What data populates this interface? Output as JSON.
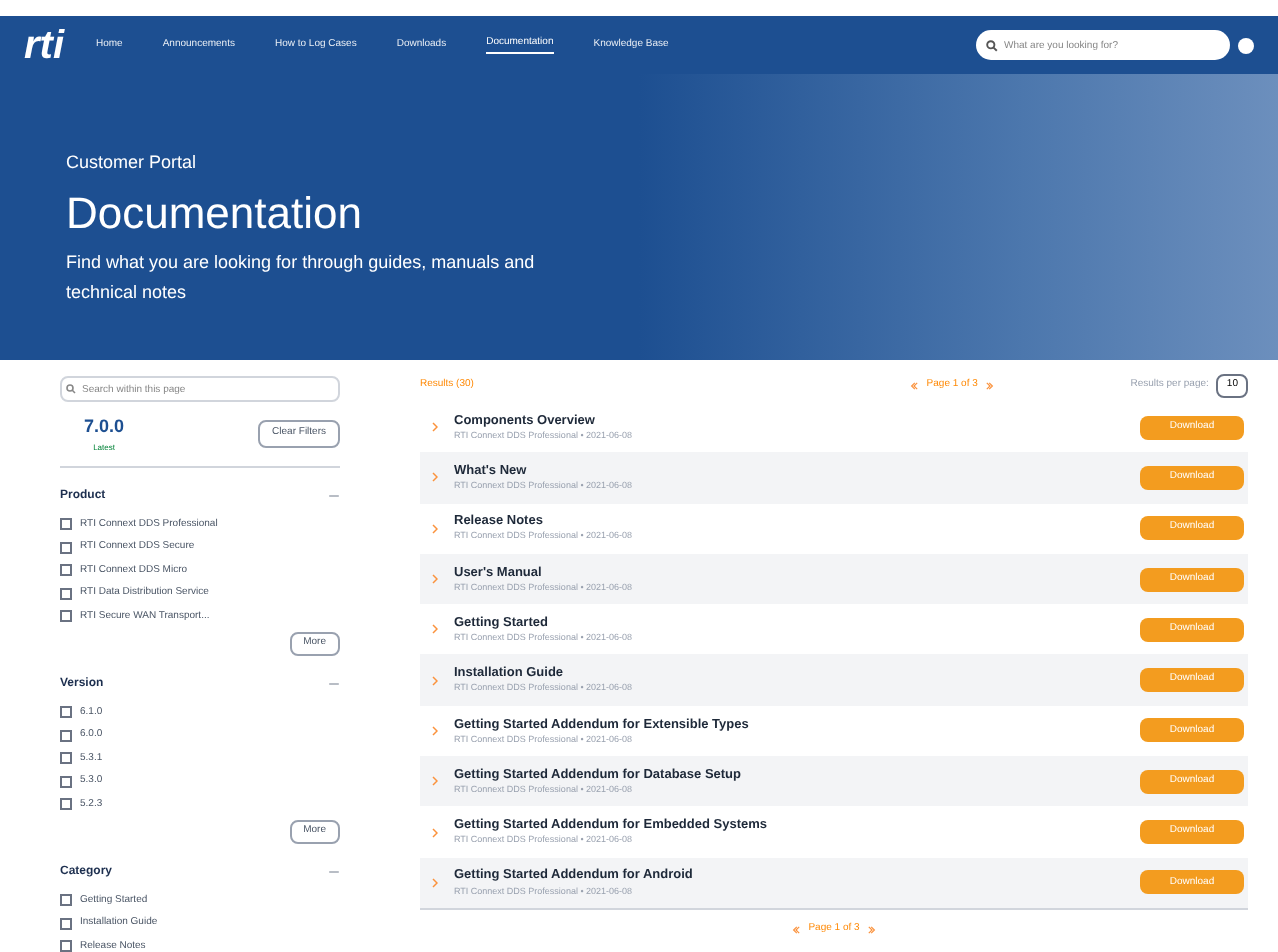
{
  "nav": {
    "logo": "rti",
    "items": [
      {
        "label": "Home",
        "selected": false
      },
      {
        "label": "Announcements",
        "selected": false
      },
      {
        "label": "How to Log Cases",
        "selected": false
      },
      {
        "label": "Downloads",
        "selected": false
      },
      {
        "label": "Documentation",
        "selected": true
      },
      {
        "label": "Knowledge Base",
        "selected": false
      }
    ],
    "search": {
      "placeholder": "What are you looking for?"
    }
  },
  "hero": {
    "eyebrow": "Customer Portal",
    "title": "Documentation",
    "subtitle": "Find what you are looking for through guides, manuals and technical notes"
  },
  "sidebar": {
    "search": {
      "placeholder": "Search within this page"
    },
    "version_badge": "7.0.0",
    "version_caption": "Latest",
    "clear_button": "Clear Filters",
    "groups": [
      {
        "title": "Product",
        "expanded": true,
        "options": [
          {
            "label": "RTI Connext DDS Professional",
            "checked": false
          },
          {
            "label": "RTI Connext DDS Secure",
            "checked": false
          },
          {
            "label": "RTI Connext DDS Micro",
            "checked": false
          },
          {
            "label": "RTI Data Distribution Service",
            "checked": false
          },
          {
            "label": "RTI Secure WAN Transport...",
            "checked": false
          }
        ],
        "more": "More"
      },
      {
        "title": "Version",
        "expanded": true,
        "options": [
          {
            "label": "6.1.0",
            "checked": false
          },
          {
            "label": "6.0.0",
            "checked": false
          },
          {
            "label": "5.3.1",
            "checked": false
          },
          {
            "label": "5.3.0",
            "checked": false
          },
          {
            "label": "5.2.3",
            "checked": false
          }
        ],
        "more": "More"
      },
      {
        "title": "Category",
        "expanded": true,
        "options": [
          {
            "label": "Getting Started",
            "checked": false
          },
          {
            "label": "Installation Guide",
            "checked": false
          },
          {
            "label": "Release Notes",
            "checked": false
          }
        ]
      }
    ]
  },
  "results": {
    "count": "Results (30)",
    "pager_top": "Page 1 of 3",
    "per_page_label": "Results per page:",
    "per_page": "10",
    "pager_bottom": "Page 1 of 3",
    "items": [
      {
        "title": "Components Overview",
        "meta": "RTI Connext DDS Professional • 2021-06-08",
        "button": "Download"
      },
      {
        "title": "What's New",
        "meta": "RTI Connext DDS Professional • 2021-06-08",
        "button": "Download"
      },
      {
        "title": "Release Notes",
        "meta": "RTI Connext DDS Professional • 2021-06-08",
        "button": "Download"
      },
      {
        "title": "User's Manual",
        "meta": "RTI Connext DDS Professional • 2021-06-08",
        "button": "Download"
      },
      {
        "title": "Getting Started",
        "meta": "RTI Connext DDS Professional • 2021-06-08",
        "button": "Download"
      },
      {
        "title": "Installation Guide",
        "meta": "RTI Connext DDS Professional • 2021-06-08",
        "button": "Download"
      },
      {
        "title": "Getting Started Addendum for Extensible Types",
        "meta": "RTI Connext DDS Professional • 2021-06-08",
        "button": "Download"
      },
      {
        "title": "Getting Started Addendum for Database Setup",
        "meta": "RTI Connext DDS Professional • 2021-06-08",
        "button": "Download"
      },
      {
        "title": "Getting Started Addendum for Embedded Systems",
        "meta": "RTI Connext DDS Professional • 2021-06-08",
        "button": "Download"
      },
      {
        "title": "Getting Started Addendum for Android",
        "meta": "RTI Connext DDS Professional • 2021-06-08",
        "button": "Download"
      }
    ]
  }
}
